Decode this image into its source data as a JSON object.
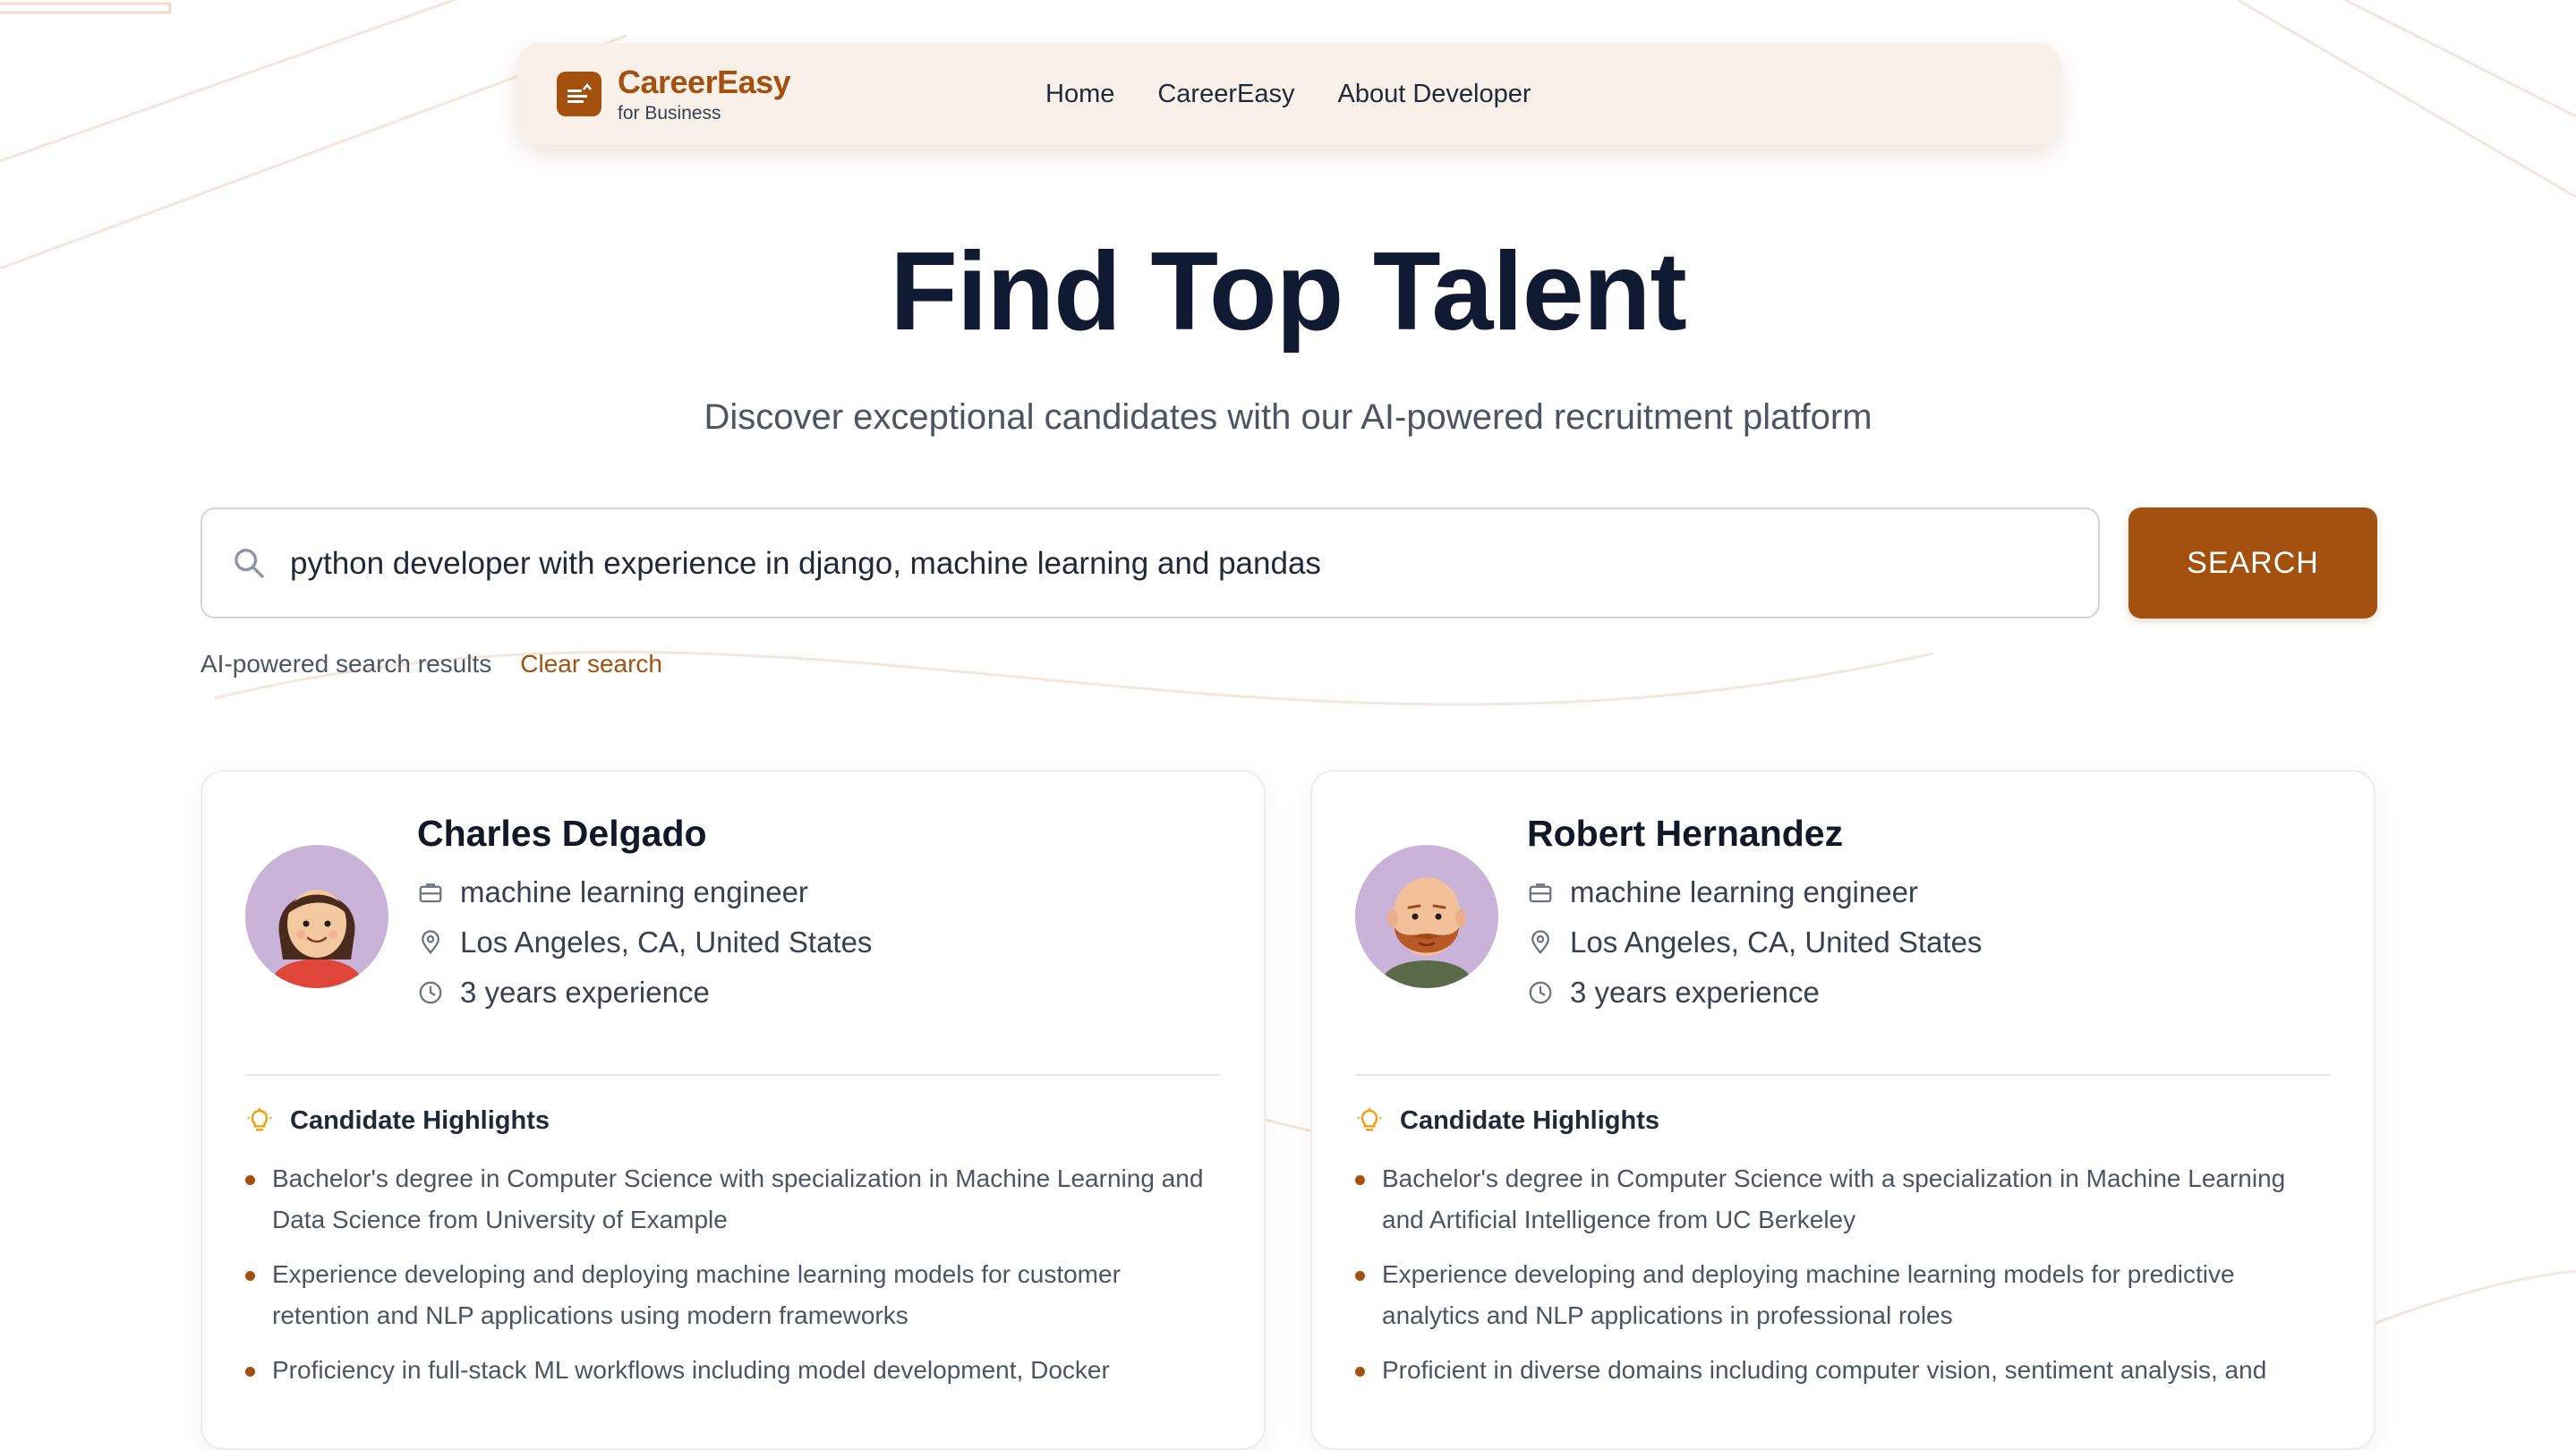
{
  "brand": {
    "name": "CareerEasy",
    "tagline": "for Business",
    "accent": "#a4510f"
  },
  "nav": {
    "links": [
      "Home",
      "CareerEasy",
      "About Developer"
    ]
  },
  "hero": {
    "title": "Find Top Talent",
    "subtitle": "Discover exceptional candidates with our AI-powered recruitment platform"
  },
  "search": {
    "value": "python developer with experience in django, machine learning and pandas",
    "button_label": "SEARCH",
    "results_label": "AI-powered search results",
    "clear_label": "Clear search"
  },
  "highlights_title": "Candidate Highlights",
  "candidates": [
    {
      "name": "Charles Delgado",
      "title": "machine learning engineer",
      "location": "Los Angeles, CA, United States",
      "experience": "3 years experience",
      "highlights": [
        "Bachelor's degree in Computer Science with specialization in Machine Learning and Data Science from University of Example",
        "Experience developing and deploying machine learning models for customer retention and NLP applications using modern frameworks",
        "Proficiency in full-stack ML workflows including model development, Docker"
      ]
    },
    {
      "name": "Robert Hernandez",
      "title": "machine learning engineer",
      "location": "Los Angeles, CA, United States",
      "experience": "3 years experience",
      "highlights": [
        "Bachelor's degree in Computer Science with a specialization in Machine Learning and Artificial Intelligence from UC Berkeley",
        "Experience developing and deploying machine learning models for predictive analytics and NLP applications in professional roles",
        "Proficient in diverse domains including computer vision, sentiment analysis, and"
      ]
    }
  ]
}
